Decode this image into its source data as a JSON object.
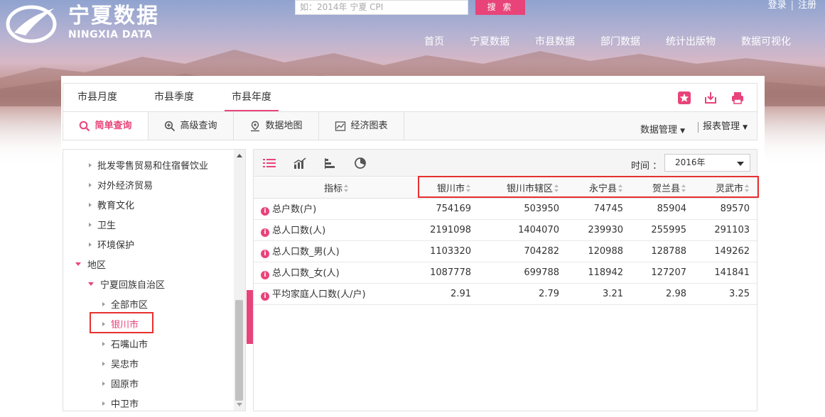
{
  "header": {
    "logo_cn": "宁夏数据",
    "logo_en": "NINGXIA DATA",
    "search_placeholder": "如：2014年 宁夏 CPI",
    "search_button": "搜 索",
    "login": "登录",
    "separator": "|",
    "register": "注册",
    "nav": [
      "首页",
      "宁夏数据",
      "市县数据",
      "部门数据",
      "统计出版物",
      "数据可视化"
    ]
  },
  "tabs": [
    "市县月度",
    "市县季度",
    "市县年度"
  ],
  "active_tab": "市县年度",
  "query_buttons": [
    "简单查询",
    "高级查询",
    "数据地图",
    "经济图表"
  ],
  "management": {
    "data": "数据管理",
    "report": "报表管理"
  },
  "tree": {
    "items": [
      "批发零售贸易和住宿餐饮业",
      "对外经济贸易",
      "教育文化",
      "卫生",
      "环境保护",
      "地区",
      "宁夏回族自治区",
      "全部市区",
      "银川市",
      "石嘴山市",
      "吴忠市",
      "固原市",
      "中卫市"
    ]
  },
  "toolbar": {
    "time_label": "时间 ：",
    "time_value": "2016年",
    "view_icons": [
      "list-view-icon",
      "chart-view-icon",
      "bar-view-icon",
      "pie-view-icon"
    ]
  },
  "table": {
    "headers": [
      "指标",
      "银川市",
      "银川市辖区",
      "永宁县",
      "贺兰县",
      "灵武市"
    ],
    "rows": [
      {
        "name": "总户数(户)",
        "values": [
          "754169",
          "503950",
          "74745",
          "85904",
          "89570"
        ]
      },
      {
        "name": "总人口数(人)",
        "values": [
          "2191098",
          "1404070",
          "239930",
          "255995",
          "291103"
        ]
      },
      {
        "name": "总人口数_男(人)",
        "values": [
          "1103320",
          "704282",
          "120988",
          "128788",
          "149262"
        ]
      },
      {
        "name": "总人口数_女(人)",
        "values": [
          "1087778",
          "699788",
          "118942",
          "127207",
          "141841"
        ]
      },
      {
        "name": "平均家庭人口数(人/户)",
        "values": [
          "2.91",
          "2.79",
          "3.21",
          "2.98",
          "3.25"
        ]
      }
    ]
  },
  "colors": {
    "accent": "#e8447a",
    "highlight": "#e83030"
  }
}
